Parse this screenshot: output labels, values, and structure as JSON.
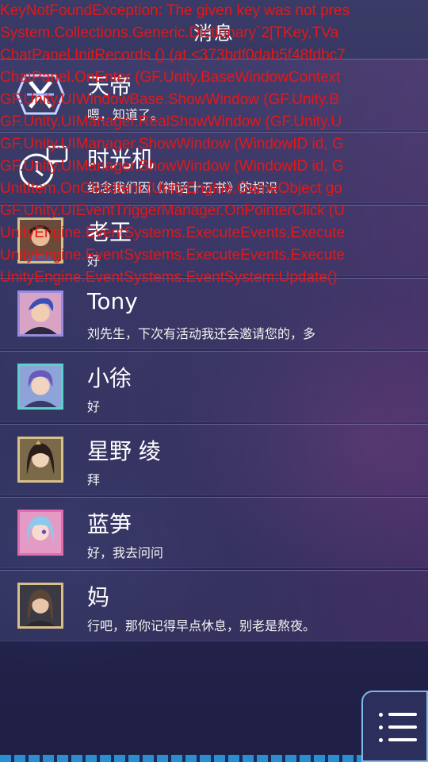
{
  "header": {
    "title": "消息"
  },
  "contacts": [
    {
      "name": "天帝",
      "last_message": "嗯，知道了。"
    },
    {
      "name": "时光机",
      "last_message": "纪念我们因《神话十五书》的相识"
    },
    {
      "name": "老王",
      "last_message": "好"
    },
    {
      "name": "Tony",
      "last_message": "刘先生，下次有活动我还会邀请您的，多"
    },
    {
      "name": "小徐",
      "last_message": "好"
    },
    {
      "name": "星野 绫",
      "last_message": "拜"
    },
    {
      "name": "蓝笋",
      "last_message": "好，我去问问"
    },
    {
      "name": "妈",
      "last_message": "行吧，那你记得早点休息，别老是熬夜。"
    }
  ],
  "error_log": [
    "KeyNotFoundException: The given key was not pres",
    "System.Collections.Generic.Dictionary`2[TKey,TVa",
    "ChatPanel.InitRecords () (at <373bdf0dab5f48fdbc7",
    "ChatPanel.OnEnter (GF.Unity.BaseWindowContext",
    "GF.Unity.UIWindowBase.ShowWindow (GF.Unity.B",
    "GF.Unity.UIManager.RealShowWindow (GF.Unity.U",
    "GF.Unity.UIManager.ShowWindow (WindowID id, G",
    "GF.Unity.UIManager.ShowWindow (WindowID id, G",
    "UnitItem.OnClickItem (UnityEngine.GameObject go",
    "GF.Unity.UIEventTriggerManager.OnPointerClick (U",
    "UnityEngine.EventSystems.ExecuteEvents.Execute",
    "UnityEngine.EventSystems.ExecuteEvents.Execute",
    "UnityEngine.EventSystems.EventSystem:Update()"
  ],
  "menu": {
    "icon": "menu-icon"
  },
  "colors": {
    "error_text": "#e31818",
    "accent_blue": "#2a8fd1"
  }
}
